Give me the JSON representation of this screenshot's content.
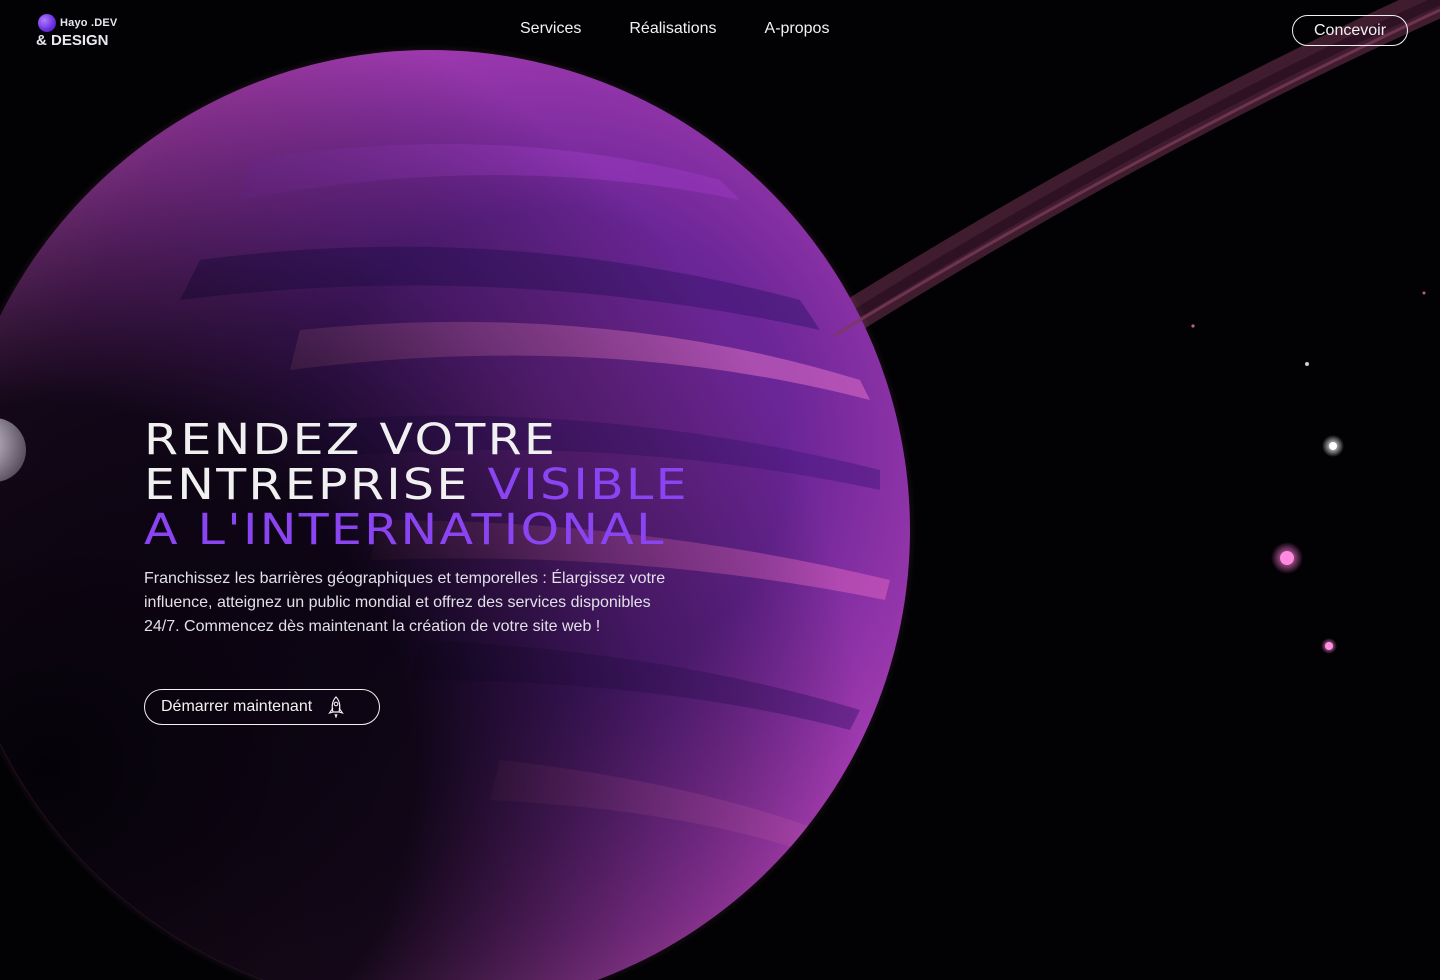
{
  "brand": {
    "line1": "Hayo .DEV",
    "line2": "& DESIGN"
  },
  "nav": {
    "items": [
      {
        "label": "Services"
      },
      {
        "label": "Réalisations"
      },
      {
        "label": "A-propos"
      }
    ]
  },
  "header_cta": {
    "label": "Concevoir"
  },
  "hero": {
    "title_line1": "RENDEZ VOTRE",
    "title_line2_white": "ENTREPRISE",
    "title_line2_purple": "VISIBLE",
    "title_line3": "A L'INTERNATIONAL",
    "description": "Franchissez les barrières géographiques et temporelles : Élargissez votre influence, atteignez un public mondial et offrez des services disponibles 24/7. Commencez dès maintenant la création de votre site web !",
    "cta_label": "Démarrer maintenant",
    "cta_icon": "rocket-icon"
  },
  "colors": {
    "accent": "#8a44f2",
    "background": "#020104",
    "planet": "#c050c8"
  }
}
